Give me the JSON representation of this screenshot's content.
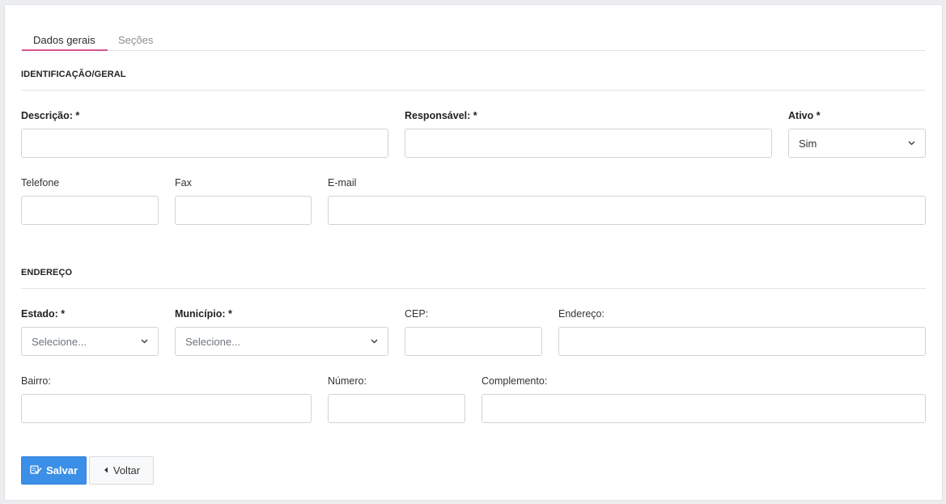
{
  "tabs": [
    {
      "label": "Dados gerais",
      "active": true
    },
    {
      "label": "Seções",
      "active": false
    }
  ],
  "sections": {
    "identificacao": "IDENTIFICAÇÃO/GERAL",
    "endereco": "ENDEREÇO"
  },
  "fields": {
    "descricao": {
      "label": "Descrição: *",
      "value": ""
    },
    "responsavel": {
      "label": "Responsável: *",
      "value": ""
    },
    "ativo": {
      "label": "Ativo *",
      "value": "Sim"
    },
    "telefone": {
      "label": "Telefone",
      "value": ""
    },
    "fax": {
      "label": "Fax",
      "value": ""
    },
    "email": {
      "label": "E-mail",
      "value": ""
    },
    "estado": {
      "label": "Estado: *",
      "placeholder": "Selecione..."
    },
    "municipio": {
      "label": "Município: *",
      "placeholder": "Selecione..."
    },
    "cep": {
      "label": "CEP:",
      "value": ""
    },
    "endereco": {
      "label": "Endereço:",
      "value": ""
    },
    "bairro": {
      "label": "Bairro:",
      "value": ""
    },
    "numero": {
      "label": "Número:",
      "value": ""
    },
    "complemento": {
      "label": "Complemento:",
      "value": ""
    }
  },
  "buttons": {
    "salvar": "Salvar",
    "voltar": "Voltar"
  },
  "icons": {
    "salvar": "save-check-icon",
    "voltar": "caret-left-icon",
    "select": "chevron-down-icon"
  },
  "colors": {
    "accent_tab": "#d9568f",
    "primary": "#3b8fe6"
  }
}
